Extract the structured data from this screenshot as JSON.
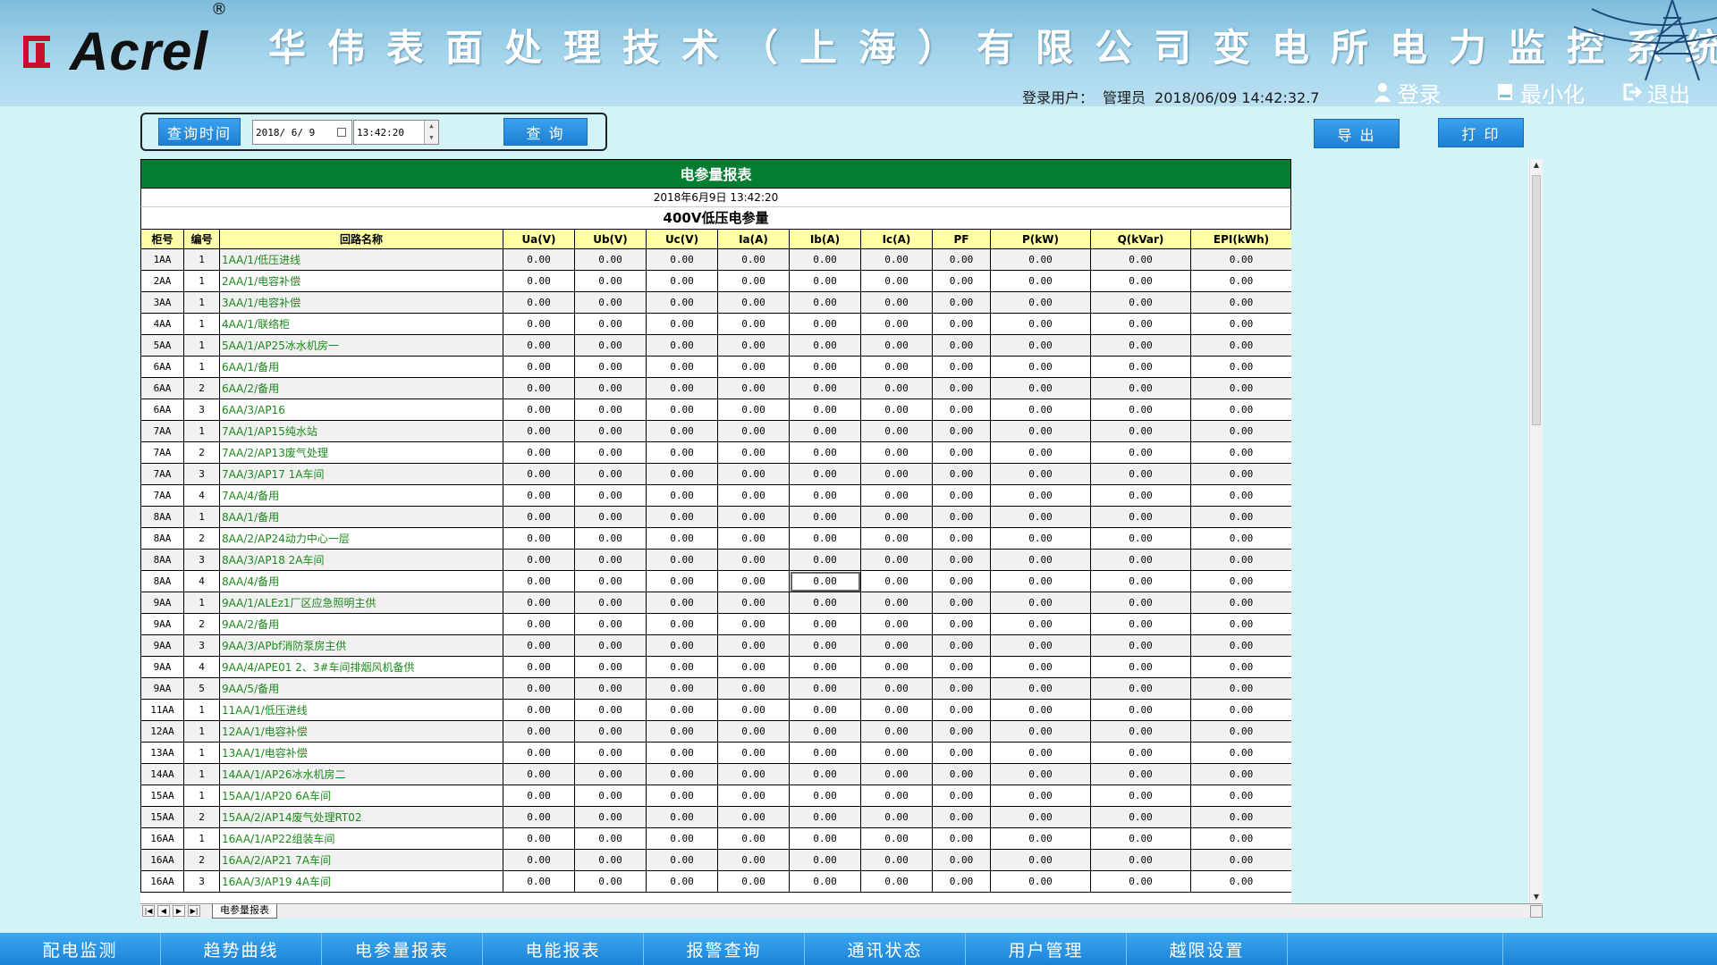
{
  "header": {
    "logo_text": "Acrel",
    "logo_reg": "®",
    "title": "华伟表面处理技术（上海）有限公司变电所电力监控系统",
    "user_label": "登录用户：",
    "user_name": "管理员",
    "datetime": "2018/06/09  14:42:32.7",
    "login_label": "登录",
    "minimize_label": "最小化",
    "exit_label": "退出"
  },
  "query": {
    "time_button": "查询时间",
    "date_value": "2018/ 6/ 9",
    "time_value": "13:42:20",
    "query_button": "查 询",
    "export_button": "导 出",
    "print_button": "打 印"
  },
  "report": {
    "title": "电参量报表",
    "date_line": "2018年6月9日  13:42:20",
    "subtitle": "400V低压电参量",
    "columns": [
      "柜号",
      "编号",
      "回路名称",
      "Ua(V)",
      "Ub(V)",
      "Uc(V)",
      "Ia(A)",
      "Ib(A)",
      "Ic(A)",
      "PF",
      "P(kW)",
      "Q(kVar)",
      "EPI(kWh)"
    ],
    "rows": [
      [
        "1AA",
        "1",
        "1AA/1/低压进线"
      ],
      [
        "2AA",
        "1",
        "2AA/1/电容补偿"
      ],
      [
        "3AA",
        "1",
        "3AA/1/电容补偿"
      ],
      [
        "4AA",
        "1",
        "4AA/1/联络柜"
      ],
      [
        "5AA",
        "1",
        "5AA/1/AP25冰水机房一"
      ],
      [
        "6AA",
        "1",
        "6AA/1/备用"
      ],
      [
        "6AA",
        "2",
        "6AA/2/备用"
      ],
      [
        "6AA",
        "3",
        "6AA/3/AP16"
      ],
      [
        "7AA",
        "1",
        "7AA/1/AP15纯水站"
      ],
      [
        "7AA",
        "2",
        "7AA/2/AP13废气处理"
      ],
      [
        "7AA",
        "3",
        "7AA/3/AP17  1A车间"
      ],
      [
        "7AA",
        "4",
        "7AA/4/备用"
      ],
      [
        "8AA",
        "1",
        "8AA/1/备用"
      ],
      [
        "8AA",
        "2",
        "8AA/2/AP24动力中心一层"
      ],
      [
        "8AA",
        "3",
        "8AA/3/AP18  2A车间"
      ],
      [
        "8AA",
        "4",
        "8AA/4/备用"
      ],
      [
        "9AA",
        "1",
        "9AA/1/ALEz1厂区应急照明主供"
      ],
      [
        "9AA",
        "2",
        "9AA/2/备用"
      ],
      [
        "9AA",
        "3",
        "9AA/3/APbf消防泵房主供"
      ],
      [
        "9AA",
        "4",
        "9AA/4/APE01 2、3#车间排烟风机备供"
      ],
      [
        "9AA",
        "5",
        "9AA/5/备用"
      ],
      [
        "11AA",
        "1",
        "11AA/1/低压进线"
      ],
      [
        "12AA",
        "1",
        "12AA/1/电容补偿"
      ],
      [
        "13AA",
        "1",
        "13AA/1/电容补偿"
      ],
      [
        "14AA",
        "1",
        "14AA/1/AP26冰水机房二"
      ],
      [
        "15AA",
        "1",
        "15AA/1/AP20  6A车间"
      ],
      [
        "15AA",
        "2",
        "15AA/2/AP14废气处理RT02"
      ],
      [
        "16AA",
        "1",
        "16AA/1/AP22组装车间"
      ],
      [
        "16AA",
        "2",
        "16AA/2/AP21  7A车间"
      ],
      [
        "16AA",
        "3",
        "16AA/3/AP19  4A车间"
      ]
    ],
    "value_text": "0.00",
    "sheet_tab": "电参量报表"
  },
  "nav": [
    "配电监测",
    "趋势曲线",
    "电参量报表",
    "电能报表",
    "报警查询",
    "通讯状态",
    "用户管理",
    "越限设置"
  ],
  "colors": {
    "title_green": "#037d31",
    "header_yellow": "#ffffa7",
    "nav_blue": "#1e82d6",
    "name_green": "#1b8a1b"
  }
}
